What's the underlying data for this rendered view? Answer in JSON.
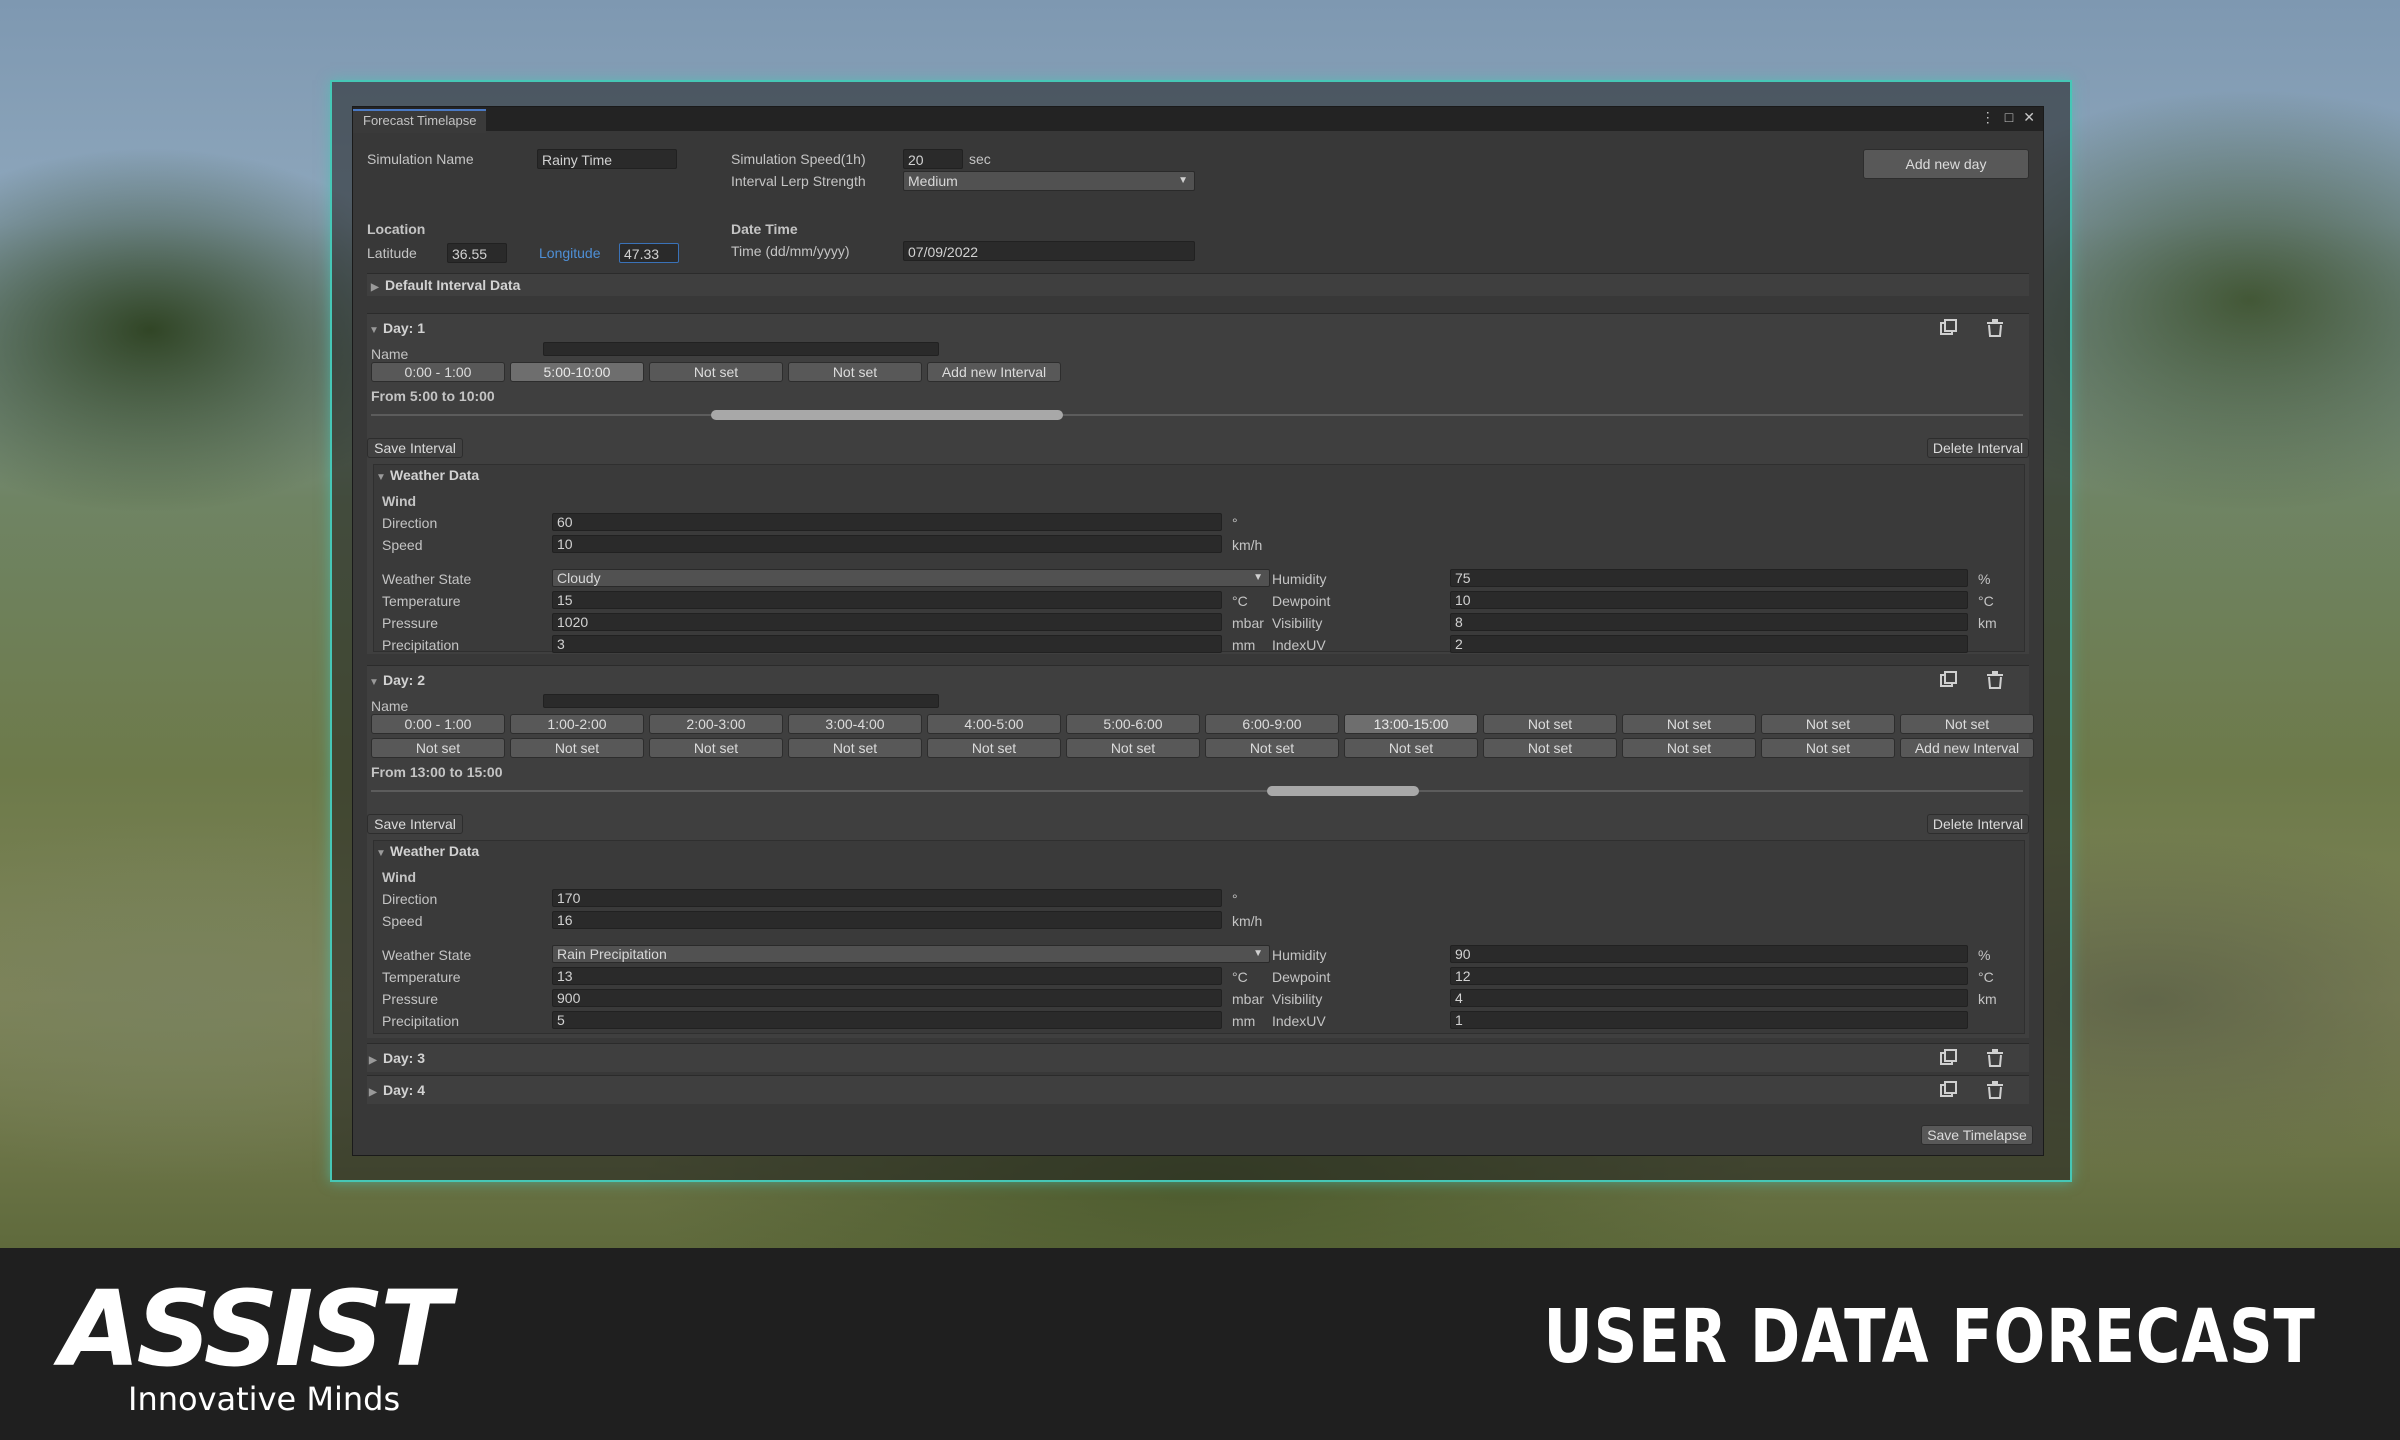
{
  "window": {
    "tab_title": "Forecast Timelapse",
    "menu_glyph": "⋮",
    "maximize_glyph": "□",
    "close_glyph": "✕"
  },
  "header": {
    "simulation_name_label": "Simulation Name",
    "simulation_name_value": "Rainy Time",
    "simulation_speed_label": "Simulation Speed(1h)",
    "simulation_speed_value": "20",
    "simulation_speed_unit": "sec",
    "lerp_label": "Interval Lerp Strength",
    "lerp_value": "Medium",
    "add_new_day": "Add new day",
    "location_label": "Location",
    "latitude_label": "Latitude",
    "latitude_value": "36.55",
    "longitude_label": "Longitude",
    "longitude_value": "47.33",
    "datetime_label": "Date Time",
    "time_label": "Time (dd/mm/yyyy)",
    "time_value": "07/09/2022",
    "default_interval": "Default Interval Data"
  },
  "days": [
    {
      "title": "Day: 1",
      "name_label": "Name",
      "intervals": [
        "0:00 - 1:00",
        "5:00-10:00",
        "Not set",
        "Not set",
        "Add new Interval"
      ],
      "from_text": "From 5:00 to 10:00",
      "save_interval": "Save Interval",
      "delete_interval": "Delete Interval",
      "weather": {
        "title": "Weather Data",
        "wind_label": "Wind",
        "direction_label": "Direction",
        "direction": "60",
        "direction_unit": "°",
        "speed_label": "Speed",
        "speed": "10",
        "speed_unit": "km/h",
        "state_label": "Weather State",
        "state": "Cloudy",
        "temperature_label": "Temperature",
        "temperature": "15",
        "temperature_unit": "°C",
        "pressure_label": "Pressure",
        "pressure": "1020",
        "pressure_unit": "mbar",
        "precipitation_label": "Precipitation",
        "precipitation": "3",
        "precipitation_unit": "mm",
        "humidity_label": "Humidity",
        "humidity": "75",
        "humidity_unit": "%",
        "dewpoint_label": "Dewpoint",
        "dewpoint": "10",
        "dewpoint_unit": "°C",
        "visibility_label": "Visibility",
        "visibility": "8",
        "visibility_unit": "km",
        "indexuv_label": "IndexUV",
        "indexuv": "2"
      }
    },
    {
      "title": "Day: 2",
      "name_label": "Name",
      "intervals_row1": [
        "0:00 - 1:00",
        "1:00-2:00",
        "2:00-3:00",
        "3:00-4:00",
        "4:00-5:00",
        "5:00-6:00",
        "6:00-9:00",
        "13:00-15:00",
        "Not set",
        "Not set",
        "Not set",
        "Not set"
      ],
      "intervals_row2": [
        "Not set",
        "Not set",
        "Not set",
        "Not set",
        "Not set",
        "Not set",
        "Not set",
        "Not set",
        "Not set",
        "Not set",
        "Not set",
        "Add new Interval"
      ],
      "from_text": "From 13:00 to 15:00",
      "save_interval": "Save Interval",
      "delete_interval": "Delete Interval",
      "weather": {
        "title": "Weather Data",
        "wind_label": "Wind",
        "direction_label": "Direction",
        "direction": "170",
        "direction_unit": "°",
        "speed_label": "Speed",
        "speed": "16",
        "speed_unit": "km/h",
        "state_label": "Weather State",
        "state": "Rain Precipitation",
        "temperature_label": "Temperature",
        "temperature": "13",
        "temperature_unit": "°C",
        "pressure_label": "Pressure",
        "pressure": "900",
        "pressure_unit": "mbar",
        "precipitation_label": "Precipitation",
        "precipitation": "5",
        "precipitation_unit": "mm",
        "humidity_label": "Humidity",
        "humidity": "90",
        "humidity_unit": "%",
        "dewpoint_label": "Dewpoint",
        "dewpoint": "12",
        "dewpoint_unit": "°C",
        "visibility_label": "Visibility",
        "visibility": "4",
        "visibility_unit": "km",
        "indexuv_label": "IndexUV",
        "indexuv": "1"
      }
    },
    {
      "title": "Day: 3"
    },
    {
      "title": "Day: 4"
    }
  ],
  "save_timelapse": "Save Timelapse",
  "footer": {
    "logo": "ASSIST",
    "tagline": "Innovative Minds",
    "title": "USER DATA FORECAST"
  },
  "colors": {
    "accent_border": "#46c7b6",
    "focus_blue": "#3a72b8",
    "panel_bg": "#383838"
  },
  "icons": [
    "copy-icon",
    "trash-icon",
    "triangle-right-icon",
    "triangle-down-icon",
    "dropdown-arrow-icon"
  ]
}
